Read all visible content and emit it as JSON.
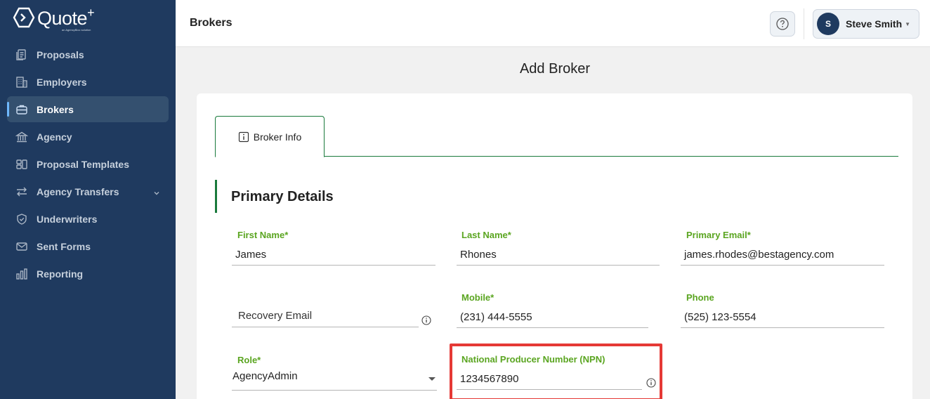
{
  "app": {
    "logo_text": "Quote",
    "logo_sup": "+",
    "logo_tagline": "an AgencyBloc solution"
  },
  "sidebar": {
    "items": [
      {
        "label": "Proposals",
        "icon": "proposals-icon"
      },
      {
        "label": "Employers",
        "icon": "building-icon"
      },
      {
        "label": "Brokers",
        "icon": "briefcase-icon",
        "active": true
      },
      {
        "label": "Agency",
        "icon": "bank-icon"
      },
      {
        "label": "Proposal Templates",
        "icon": "templates-icon"
      },
      {
        "label": "Agency Transfers",
        "icon": "transfer-icon",
        "expandable": true
      },
      {
        "label": "Underwriters",
        "icon": "shield-check-icon"
      },
      {
        "label": "Sent Forms",
        "icon": "mail-icon"
      },
      {
        "label": "Reporting",
        "icon": "bar-chart-icon"
      }
    ]
  },
  "header": {
    "title": "Brokers",
    "help_icon": "help-circle-icon",
    "user": {
      "initial": "S",
      "name": "Steve Smith"
    }
  },
  "main": {
    "form_title": "Add Broker",
    "tabs": [
      {
        "label": "Broker Info",
        "icon": "info-square-icon"
      }
    ],
    "section_title": "Primary Details",
    "fields": {
      "first_name": {
        "label": "First Name*",
        "value": "James"
      },
      "last_name": {
        "label": "Last Name*",
        "value": "Rhones"
      },
      "primary_email": {
        "label": "Primary Email*",
        "value": "james.rhodes@bestagency.com"
      },
      "recovery_email": {
        "placeholder": "Recovery Email",
        "value": ""
      },
      "mobile": {
        "label": "Mobile*",
        "value": "(231) 444-5555"
      },
      "phone": {
        "label": "Phone",
        "value": "(525) 123-5554"
      },
      "role": {
        "label": "Role*",
        "value": "AgencyAdmin"
      },
      "npn": {
        "label": "National Producer Number (NPN)",
        "value": "1234567890"
      }
    }
  },
  "colors": {
    "sidebar_bg": "#1f3a5f",
    "accent_green": "#1a7a3c",
    "label_green": "#5aa520",
    "highlight_red": "#e53935"
  }
}
